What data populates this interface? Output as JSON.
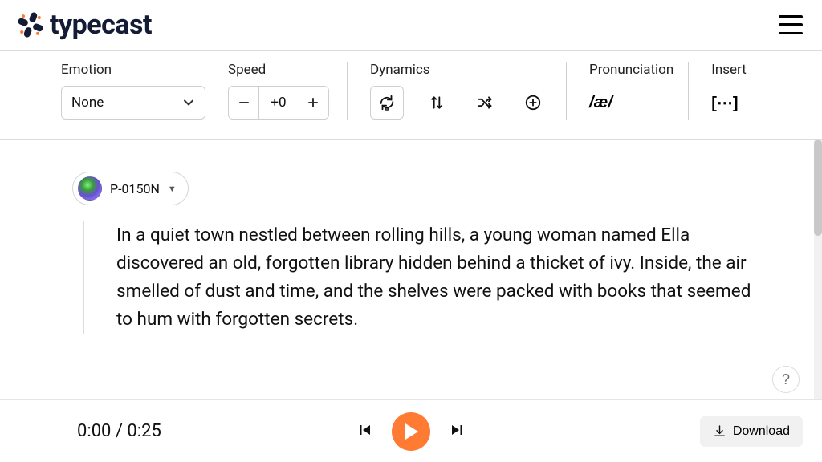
{
  "brand": "typecast",
  "toolbar": {
    "emotion": {
      "label": "Emotion",
      "value": "None"
    },
    "speed": {
      "label": "Speed",
      "value": "+0"
    },
    "dynamics": {
      "label": "Dynamics"
    },
    "pronunciation": {
      "label": "Pronunciation",
      "symbol": "/æ/"
    },
    "insert": {
      "label": "Insert",
      "symbol": "[⋯]"
    }
  },
  "editor": {
    "voice_name": "P-0150N",
    "paragraph": "In a quiet town nestled between rolling hills, a young woman named Ella discovered an old, forgotten library hidden behind a thicket of ivy. Inside, the air smelled of dust and time, and the shelves were packed with books that seemed to hum with forgotten secrets."
  },
  "player": {
    "current": "0:00",
    "total": "0:25",
    "separator": " / ",
    "download_label": "Download"
  },
  "help_label": "?"
}
